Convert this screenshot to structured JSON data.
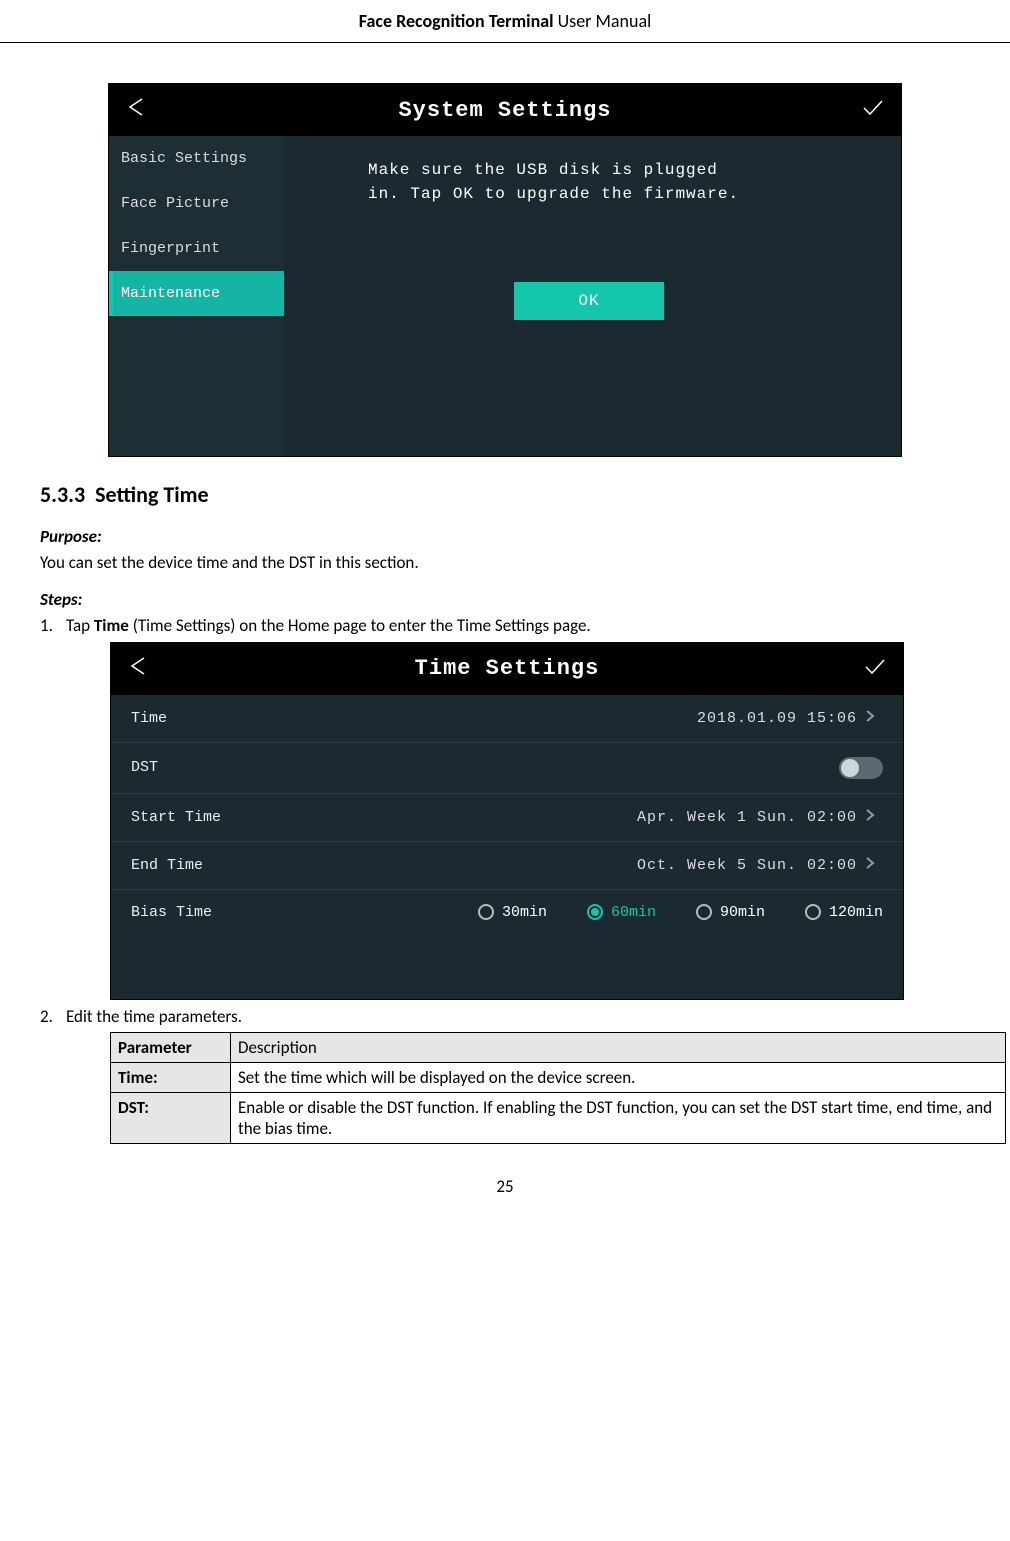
{
  "header": {
    "bold_title": "Face Recognition Terminal",
    "plain_title": " User Manual"
  },
  "page_number": "25",
  "screenshot1": {
    "title": "System Settings",
    "sidebar": {
      "items": [
        {
          "label": "Basic Settings"
        },
        {
          "label": "Face Picture"
        },
        {
          "label": "Fingerprint"
        },
        {
          "label": "Maintenance"
        }
      ]
    },
    "message_line1": "Make sure the USB disk is plugged",
    "message_line2": "in. Tap OK to upgrade the firmware.",
    "ok_label": "OK"
  },
  "section": {
    "number": "5.3.3",
    "title": "Setting Time",
    "purpose_label": "Purpose:",
    "purpose_text": "You can set the device time and the DST in this section.",
    "steps_label": "Steps:",
    "step1_num": "1.",
    "step1_pre": "Tap ",
    "step1_bold": "Time",
    "step1_post": " (Time Settings) on the Home page to enter the Time Settings page.",
    "step2_num": "2.",
    "step2_text": "Edit the time parameters."
  },
  "screenshot2": {
    "title": "Time Settings",
    "rows": {
      "time": {
        "label": "Time",
        "value": "2018.01.09  15:06"
      },
      "dst": {
        "label": "DST"
      },
      "start": {
        "label": "Start Time",
        "value": "Apr.  Week 1   Sun.   02:00"
      },
      "end": {
        "label": "End Time",
        "value": "Oct.  Week 5   Sun.   02:00"
      },
      "bias": {
        "label": "Bias Time",
        "options": [
          {
            "text": "30min"
          },
          {
            "text": "60min"
          },
          {
            "text": "90min"
          },
          {
            "text": "120min"
          }
        ]
      }
    }
  },
  "table": {
    "header_param": "Parameter",
    "header_desc": "Description",
    "rows": [
      {
        "param": "Time:",
        "desc": "Set the time which will be displayed on the device screen."
      },
      {
        "param": "DST:",
        "desc": "Enable or disable the DST function. If enabling the DST function, you can set the DST start time, end time, and the bias time."
      }
    ]
  }
}
